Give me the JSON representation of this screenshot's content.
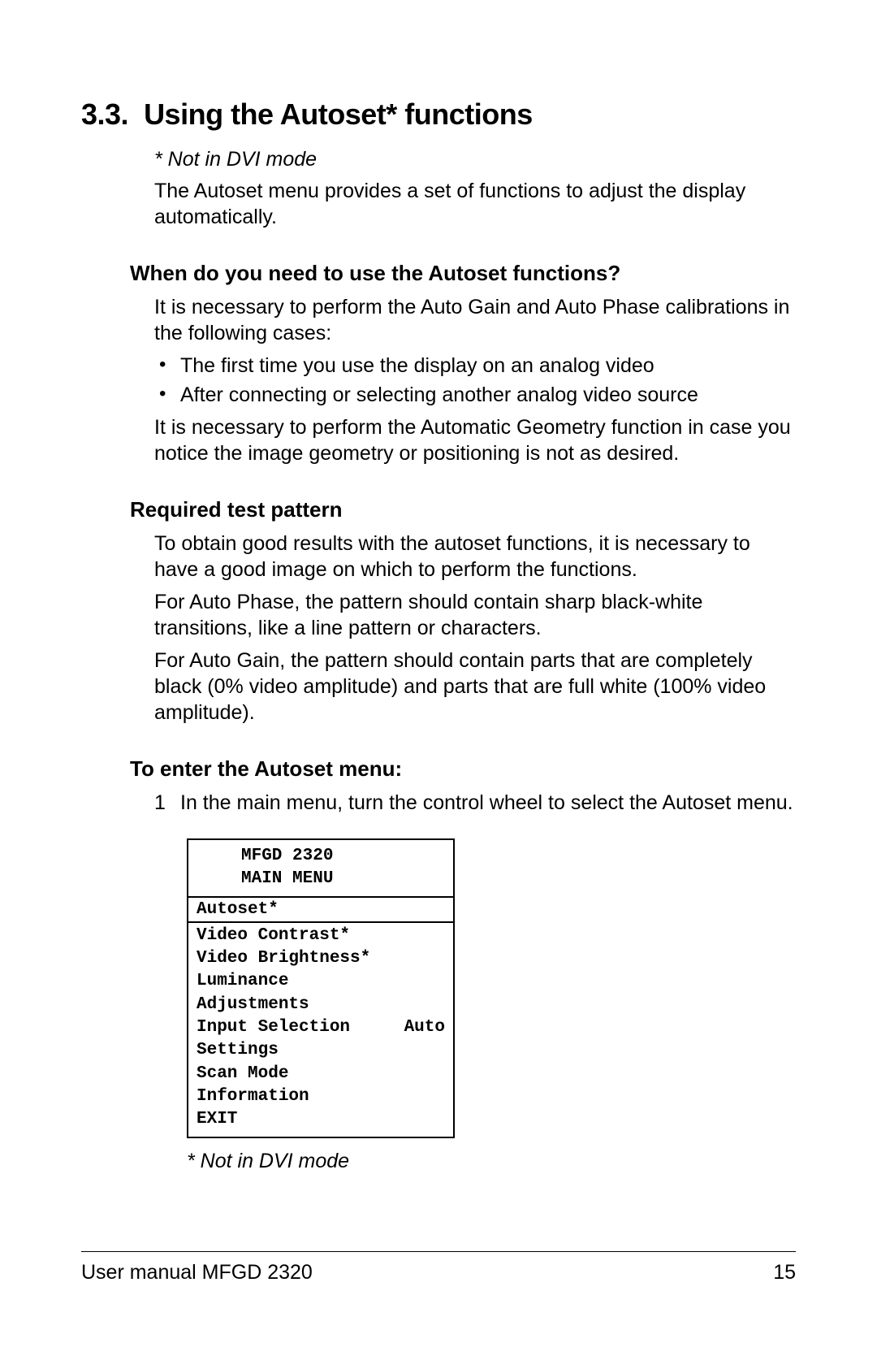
{
  "section": {
    "number": "3.3.",
    "title": "Using the Autoset* functions",
    "note": "* Not in DVI mode",
    "intro": "The Autoset menu provides a set of functions to adjust the display automatically."
  },
  "sub1": {
    "heading": "When do you need to use the Autoset functions?",
    "para1": "It is necessary to perform the Auto Gain and Auto Phase calibrations in the following cases:",
    "bullet1": "The first time you use the display on an analog video",
    "bullet2": "After connecting or selecting another analog video source",
    "para2": "It is necessary to perform the Automatic Geometry function in case you notice the image geometry or positioning is not as desired."
  },
  "sub2": {
    "heading": "Required test pattern",
    "para1": "To obtain good results with the autoset functions, it is necessary to have a good image on which to perform the functions.",
    "para2": "For Auto Phase, the pattern should contain sharp black-white transitions, like a line pattern or characters.",
    "para3": "For Auto Gain, the pattern should contain parts that are completely black (0% video amplitude) and parts that are full white (100% video amplitude)."
  },
  "sub3": {
    "heading": "To enter the Autoset menu:",
    "step1_num": "1",
    "step1_text": "In the main menu, turn the control wheel to select the Autoset menu."
  },
  "menu": {
    "header_line1": "MFGD 2320",
    "header_line2": "MAIN MENU",
    "selected": "Autoset*",
    "item1": "Video Contrast*",
    "item2": "Video Brightness*",
    "item3": "Luminance",
    "item4": "Adjustments",
    "item5_label": "Input Selection",
    "item5_value": "Auto",
    "item6": "Settings",
    "item7": "Scan Mode",
    "item8": "Information",
    "item9": "EXIT",
    "note": "* Not in DVI mode"
  },
  "footer": {
    "left": "User manual MFGD 2320",
    "right": "15"
  }
}
